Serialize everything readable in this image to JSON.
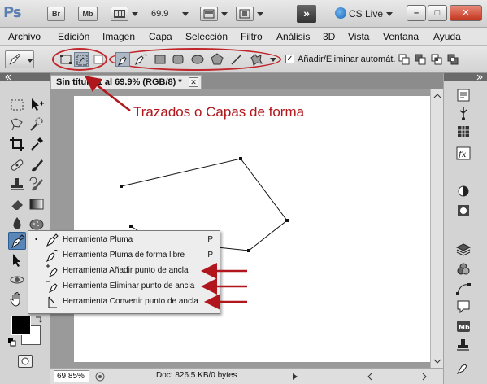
{
  "app": {
    "logo": "Ps",
    "bridge_label": "Br",
    "minibridge_label": "Mb",
    "zoom_value": "69.9",
    "workspace_arrow": "»",
    "cs_live": "CS Live",
    "window_buttons": [
      "–",
      "□",
      "✕"
    ]
  },
  "menu": [
    "Archivo",
    "Edición",
    "Imagen",
    "Capa",
    "Selección",
    "Filtro",
    "Análisis",
    "3D",
    "Vista",
    "Ventana",
    "Ayuda"
  ],
  "options_bar": {
    "auto_add_checked": "✓",
    "auto_add_label": "Añadir/Eliminar automát."
  },
  "annotation": {
    "text": "Trazados o Capas de forma",
    "color": "#b0161b"
  },
  "document": {
    "tab_title": "Sin título-1 al 69.9% (RGB/8) *",
    "tab_close": "✕",
    "status_zoom": "69.85%",
    "status_info": "Doc: 826.5 KB/0 bytes"
  },
  "flyout": {
    "items": [
      {
        "label": "Herramienta Pluma",
        "shortcut": "P",
        "selected": true,
        "icon": "pen-icon"
      },
      {
        "label": "Herramienta Pluma de forma libre",
        "shortcut": "P",
        "selected": false,
        "icon": "freeform-pen-icon"
      },
      {
        "label": "Herramienta Añadir punto de ancla",
        "shortcut": "",
        "selected": false,
        "icon": "add-anchor-icon"
      },
      {
        "label": "Herramienta Eliminar punto de ancla",
        "shortcut": "",
        "selected": false,
        "icon": "delete-anchor-icon"
      },
      {
        "label": "Herramienta Convertir punto de ancla",
        "shortcut": "",
        "selected": false,
        "icon": "convert-anchor-icon"
      }
    ],
    "bullet": "▪"
  },
  "colors": {
    "accent_red": "#c0262b",
    "active_tool": "#5b86b8"
  }
}
